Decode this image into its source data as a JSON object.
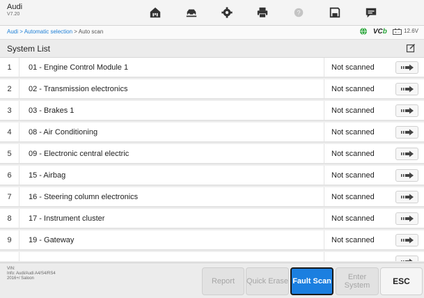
{
  "header": {
    "brand": "Audi",
    "version": "V7.20",
    "icons": [
      "home-icon",
      "vehicle-lift-icon",
      "gear-icon",
      "printer-icon",
      "help-icon",
      "save-icon",
      "message-icon"
    ]
  },
  "breadcrumb": {
    "link": "Audi > Automatic selection",
    "current": " > Auto scan"
  },
  "status": {
    "vcb": "VCB",
    "voltage": "12.6V"
  },
  "list": {
    "title": "System List",
    "rows": [
      {
        "num": "1",
        "label": "01 - Engine Control Module 1",
        "status": "Not scanned"
      },
      {
        "num": "2",
        "label": "02 - Transmission electronics",
        "status": "Not scanned"
      },
      {
        "num": "3",
        "label": "03 - Brakes 1",
        "status": "Not scanned"
      },
      {
        "num": "4",
        "label": "08 - Air Conditioning",
        "status": "Not scanned"
      },
      {
        "num": "5",
        "label": "09 - Electronic central electric",
        "status": "Not scanned"
      },
      {
        "num": "6",
        "label": "15 - Airbag",
        "status": "Not scanned"
      },
      {
        "num": "7",
        "label": "16 - Steering column electronics",
        "status": "Not scanned"
      },
      {
        "num": "8",
        "label": "17 - Instrument cluster",
        "status": "Not scanned"
      },
      {
        "num": "9",
        "label": "19 - Gateway",
        "status": "Not scanned"
      },
      {
        "num": "",
        "label": "",
        "status": ""
      }
    ]
  },
  "footer": {
    "vin_label": "VIN:",
    "info": "Info: Audi/Audi A4/S4/RS4 2016+/ Saloon",
    "report": "Report",
    "quick_erase": "Quick Erase",
    "fault_scan": "Fault Scan",
    "enter_system": "Enter System",
    "esc": "ESC"
  },
  "colors": {
    "accent": "#1b7fe0",
    "link": "#1d7fd6",
    "vcb_green": "#2aa53a"
  }
}
